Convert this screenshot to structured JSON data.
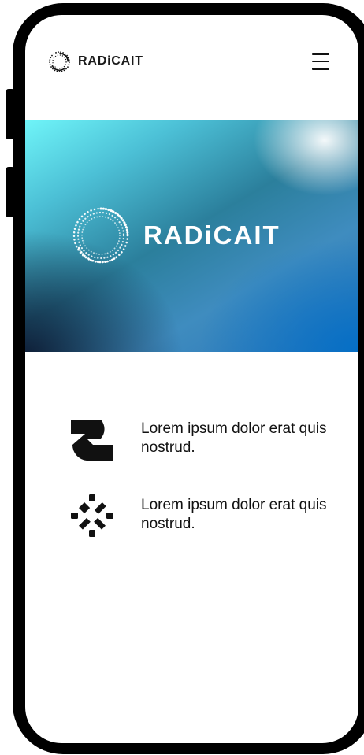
{
  "header": {
    "brand": "RADiCAIT",
    "menu_icon": "hamburger-menu-icon"
  },
  "hero": {
    "brand": "RADiCAIT",
    "logo_icon": "spiral-dots-icon"
  },
  "features": [
    {
      "icon": "wave-s-icon",
      "text": "Lorem ipsum dolor erat quis nostrud."
    },
    {
      "icon": "scatter-cross-icon",
      "text": "Lorem ipsum dolor erat quis nostrud."
    }
  ],
  "colors": {
    "hero_start": "#6ff4f8",
    "hero_end": "#2874b8",
    "divider": "#1e3a50"
  }
}
